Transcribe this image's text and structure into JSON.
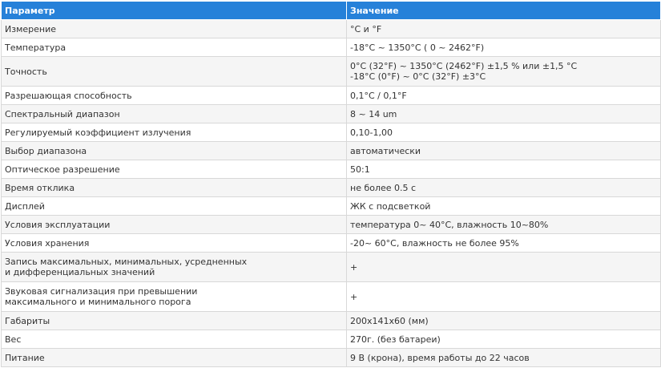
{
  "table": {
    "headers": [
      "Параметр",
      "Значение"
    ],
    "rows": [
      {
        "param": "Измерение",
        "value": "°C и °F"
      },
      {
        "param": "Температура",
        "value": "-18°C ~ 1350°C ( 0 ~ 2462°F)"
      },
      {
        "param": "Точность",
        "value": "0°C (32°F) ~ 1350°C (2462°F) ±1,5 % или ±1,5 °C\n-18°C (0°F) ~ 0°C (32°F) ±3°C"
      },
      {
        "param": "Разрешающая способность",
        "value": "0,1°C / 0,1°F"
      },
      {
        "param": "Спектральный диапазон",
        "value": "8 ~ 14 um"
      },
      {
        "param": "Регулируемый коэффициент излучения",
        "value": "0,10-1,00"
      },
      {
        "param": "Выбор диапазона",
        "value": "автоматически"
      },
      {
        "param": "Оптическое разрешение",
        "value": "50:1"
      },
      {
        "param": "Время отклика",
        "value": "не более 0.5 с"
      },
      {
        "param": "Дисплей",
        "value": "ЖК с подсветкой"
      },
      {
        "param": "Условия эксплуатации",
        "value": "температура 0~ 40°C, влажность 10~80%"
      },
      {
        "param": "Условия хранения",
        "value": "-20~ 60°C, влажность не более 95%"
      },
      {
        "param": "Запись максимальных, минимальных, усредненных\nи дифференциальных значений",
        "value": "+"
      },
      {
        "param": "Звуковая сигнализация при превышении\nмаксимального и минимального порога",
        "value": "+"
      },
      {
        "param": "Габариты",
        "value": "200x141x60 (мм)"
      },
      {
        "param": "Вес",
        "value": "270г. (без батареи)"
      },
      {
        "param": "Питание",
        "value": "9 В (крона), время работы до 22 часов"
      }
    ]
  }
}
